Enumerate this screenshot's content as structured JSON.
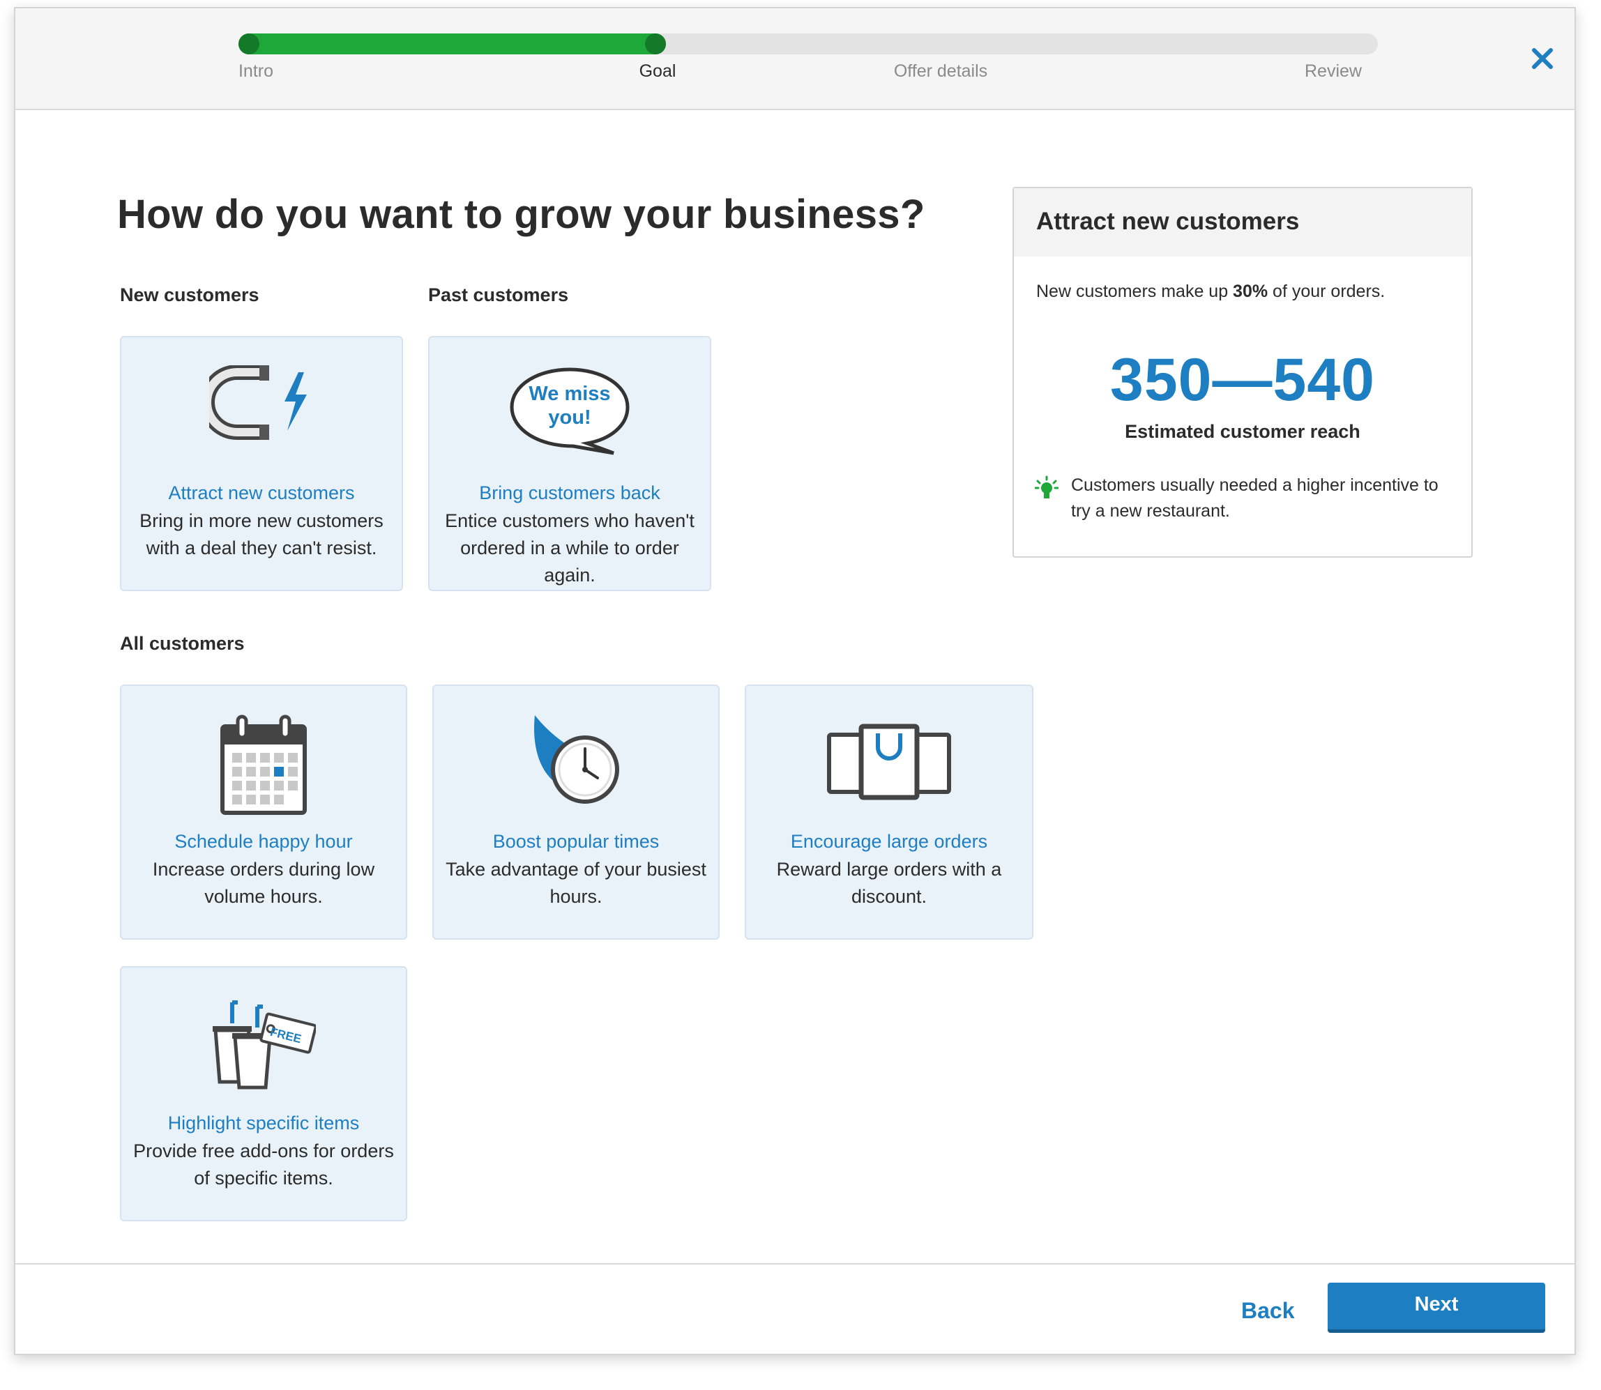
{
  "progress": {
    "fraction": 0.375,
    "steps": [
      {
        "label": "Intro",
        "state": "done"
      },
      {
        "label": "Goal",
        "state": "active"
      },
      {
        "label": "Offer details",
        "state": "upcoming"
      },
      {
        "label": "Review",
        "state": "upcoming"
      }
    ]
  },
  "close_icon": "close-icon",
  "page_title": "How do you want to grow your business?",
  "sections": {
    "new_customers": "New customers",
    "past_customers": "Past customers",
    "all_customers": "All customers"
  },
  "cards": {
    "attract": {
      "icon": "magnet-lightning-icon",
      "title": "Attract new customers",
      "desc": "Bring in more new customers with a deal they can't resist."
    },
    "bring_back": {
      "icon": "speech-bubble-icon",
      "icon_text_line1": "We miss",
      "icon_text_line2": "you!",
      "title": "Bring customers back",
      "desc": "Entice customers who haven't ordered in a while to order again."
    },
    "happy_hour": {
      "icon": "calendar-icon",
      "title": "Schedule happy hour",
      "desc": "Increase orders during low volume hours."
    },
    "boost": {
      "icon": "fast-clock-icon",
      "title": "Boost popular times",
      "desc": "Take advantage of your busiest hours."
    },
    "large_orders": {
      "icon": "shopping-bags-icon",
      "title": "Encourage large orders",
      "desc": "Reward large orders with a discount."
    },
    "specific_items": {
      "icon": "free-tag-cups-icon",
      "icon_tag_text": "FREE",
      "title": "Highlight specific items",
      "desc": "Provide free add-ons for orders of specific items."
    }
  },
  "side_panel": {
    "title": "Attract new customers",
    "text_before": "New customers make up ",
    "percent": "30%",
    "text_after": " of your orders.",
    "reach": "350—540",
    "reach_label": "Estimated customer reach",
    "tip_icon": "lightbulb-icon",
    "tip": "Customers usually needed a higher incentive to try a new restaurant."
  },
  "footer": {
    "back_label": "Back",
    "next_label": "Next"
  },
  "colors": {
    "accent": "#1d7ec2",
    "progress_green": "#1fa83a",
    "progress_dot": "#147a29",
    "card_bg": "#eaf2f9"
  }
}
